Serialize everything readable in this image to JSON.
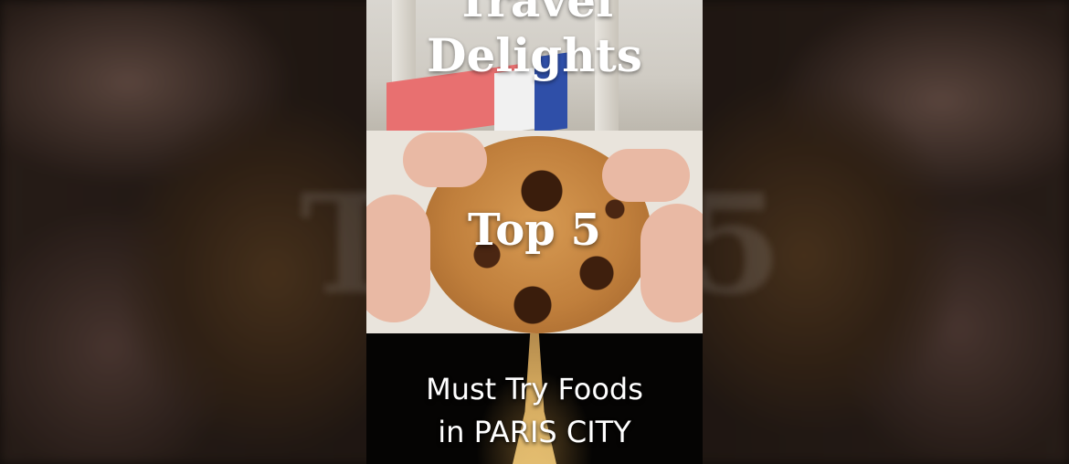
{
  "video": {
    "title_line1": "Travel",
    "title_line2": "Delights",
    "headline": "Top 5",
    "subtitle_line1": "Must Try Foods",
    "subtitle_line2": "in PARIS CITY"
  },
  "background": {
    "ghost_left": "T",
    "ghost_right": "5"
  },
  "colors": {
    "text": "#ffffff",
    "flag_blue": "#2f4fa8",
    "flag_red": "#e87070",
    "cookie": "#c07f3c",
    "tower_light": "#f3cb79"
  }
}
